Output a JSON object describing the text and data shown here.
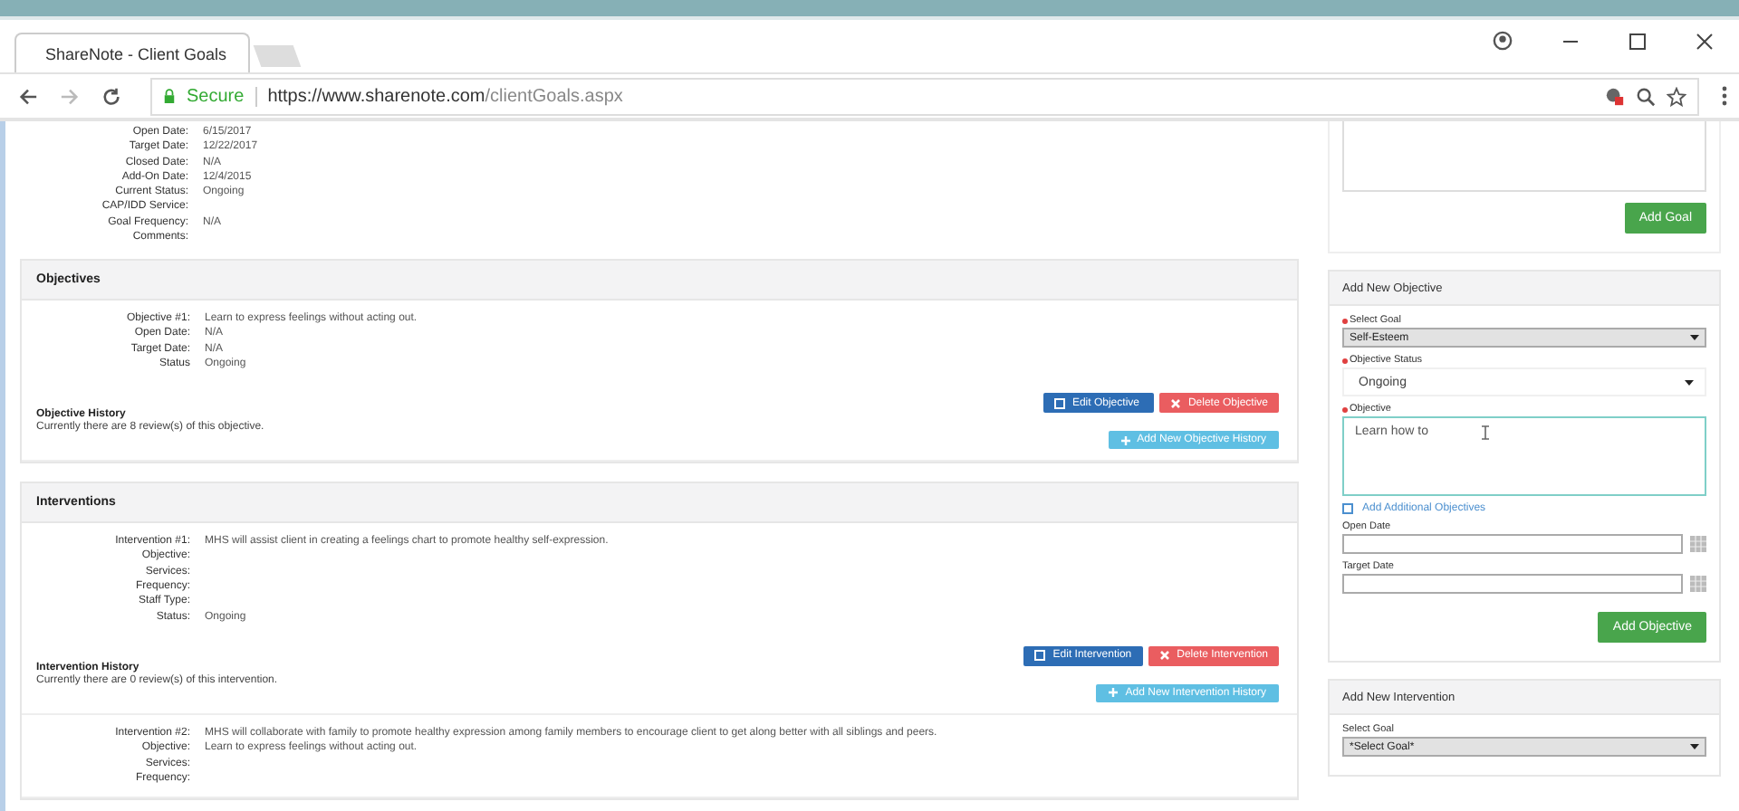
{
  "browser": {
    "tab_title": "ShareNote - Client Goals",
    "secure_label": "Secure",
    "url_host": "https://www.sharenote.com",
    "url_path": "/clientGoals.aspx"
  },
  "goal_details": [
    {
      "label": "Open Date:",
      "value": "6/15/2017"
    },
    {
      "label": "Target Date:",
      "value": "12/22/2017"
    },
    {
      "label": "Closed Date:",
      "value": "N/A"
    },
    {
      "label": "Add-On Date:",
      "value": "12/4/2015"
    },
    {
      "label": "Current Status:",
      "value": "Ongoing"
    },
    {
      "label": "CAP/IDD Service:"
    },
    {
      "label": "Goal Frequency:",
      "value": "N/A"
    },
    {
      "label": "Comments:"
    }
  ],
  "sections": [
    {
      "title": "Objectives",
      "items": [
        {
          "fields": [
            {
              "label": "Objective #1:",
              "value": "Learn to express feelings without acting out."
            },
            {
              "label": "Open Date:",
              "value": "N/A"
            },
            {
              "label": "Target Date:",
              "value": "N/A"
            },
            {
              "label": "Status",
              "value": "Ongoing"
            }
          ],
          "buttons": [
            {
              "label": "Edit Objective",
              "kind": "edit"
            },
            {
              "label": "Delete Objective",
              "kind": "delete"
            }
          ],
          "history_title": "Objective History",
          "history_text": "Currently there are 8 review(s) of this objective.",
          "history_button": "Add New Objective History"
        }
      ]
    },
    {
      "title": "Interventions",
      "items": [
        {
          "fields": [
            {
              "label": "Intervention #1:",
              "value": "MHS will assist client in creating a feelings chart to promote healthy self-expression."
            },
            {
              "label": "Objective:"
            },
            {
              "label": "Services:"
            },
            {
              "label": "Frequency:"
            },
            {
              "label": "Staff Type:"
            },
            {
              "label": "Status:",
              "value": "Ongoing"
            }
          ],
          "buttons": [
            {
              "label": "Edit Intervention",
              "kind": "edit"
            },
            {
              "label": "Delete Intervention",
              "kind": "delete"
            }
          ],
          "history_title": "Intervention History",
          "history_text": "Currently there are 0 review(s) of this intervention.",
          "history_button": "Add New Intervention History"
        },
        {
          "fields": [
            {
              "label": "Intervention #2:",
              "value": "MHS will collaborate with family to promote healthy expression among family members to encourage client to get along better with all siblings and peers."
            },
            {
              "label": "Objective:",
              "value": "Learn to express feelings without acting out."
            },
            {
              "label": "Services:"
            },
            {
              "label": "Frequency:"
            }
          ]
        }
      ]
    }
  ],
  "add_goal_button": "Add Goal",
  "panels": [
    {
      "title": "Add New Objective",
      "fields": [
        {
          "kind": "select",
          "label": "Select Goal",
          "required": true,
          "value": "Self-Esteem"
        },
        {
          "kind": "plain-select",
          "label": "Objective Status",
          "required": true,
          "value": "Ongoing"
        },
        {
          "kind": "textarea",
          "label": "Objective",
          "required": true,
          "value": "Learn how to"
        },
        {
          "kind": "checkbox",
          "label": "Add Additional Objectives",
          "checked": false
        },
        {
          "kind": "date",
          "label": "Open Date",
          "required": false
        },
        {
          "kind": "date",
          "label": "Target Date",
          "required": false
        }
      ],
      "button": "Add Objective"
    },
    {
      "title": "Add New Intervention",
      "fields": [
        {
          "kind": "select",
          "label": "Select Goal",
          "required": false,
          "value": "*Select Goal*"
        }
      ]
    }
  ]
}
